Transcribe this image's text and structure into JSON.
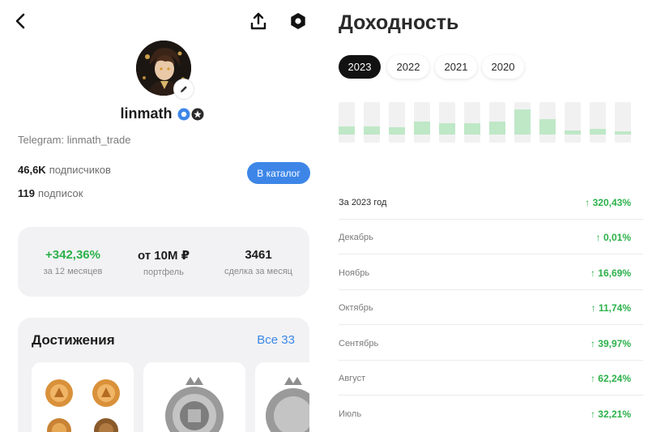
{
  "profile": {
    "username": "linmath",
    "telegram": "Telegram: linmath_trade",
    "subscribers_count": "46,6K",
    "subscribers_label": "подписчиков",
    "following_count": "119",
    "following_label": "подписок",
    "catalog_button": "В каталог"
  },
  "icons": {
    "back": "chevron-left-icon",
    "share": "share-icon",
    "settings": "settings-icon",
    "edit": "pencil-icon",
    "verified": "verified-badge-icon",
    "star": "star-badge-icon"
  },
  "stats": [
    {
      "value": "+342,36%",
      "label": "за 12 месяцев"
    },
    {
      "value": "от 10М ₽",
      "label": "портфель"
    },
    {
      "value": "3461",
      "label": "сделка за месяц"
    }
  ],
  "achievements": {
    "title": "Достижения",
    "all_link": "Все 33"
  },
  "returns": {
    "title": "Доходность",
    "years": [
      "2023",
      "2022",
      "2021",
      "2020"
    ],
    "selected_year": "2023",
    "rows": [
      {
        "label": "За 2023 год",
        "value": "↑ 320,43%"
      },
      {
        "label": "Декабрь",
        "value": "↑ 0,01%"
      },
      {
        "label": "Ноябрь",
        "value": "↑ 16,69%"
      },
      {
        "label": "Октябрь",
        "value": "↑ 11,74%"
      },
      {
        "label": "Сентябрь",
        "value": "↑ 39,97%"
      },
      {
        "label": "Август",
        "value": "↑ 62,24%"
      },
      {
        "label": "Июль",
        "value": "↑ 32,21%"
      }
    ]
  },
  "chart_data": {
    "type": "bar",
    "bar_levels": [
      0.2,
      0.2,
      0.18,
      0.3,
      0.26,
      0.26,
      0.3,
      0.6,
      0.36,
      0.1,
      0.14,
      0.08
    ]
  },
  "colors": {
    "accent": "#3d86e8",
    "positive": "#2bb14a",
    "bar": "#bfe8c7",
    "pill_active": "#121212"
  }
}
